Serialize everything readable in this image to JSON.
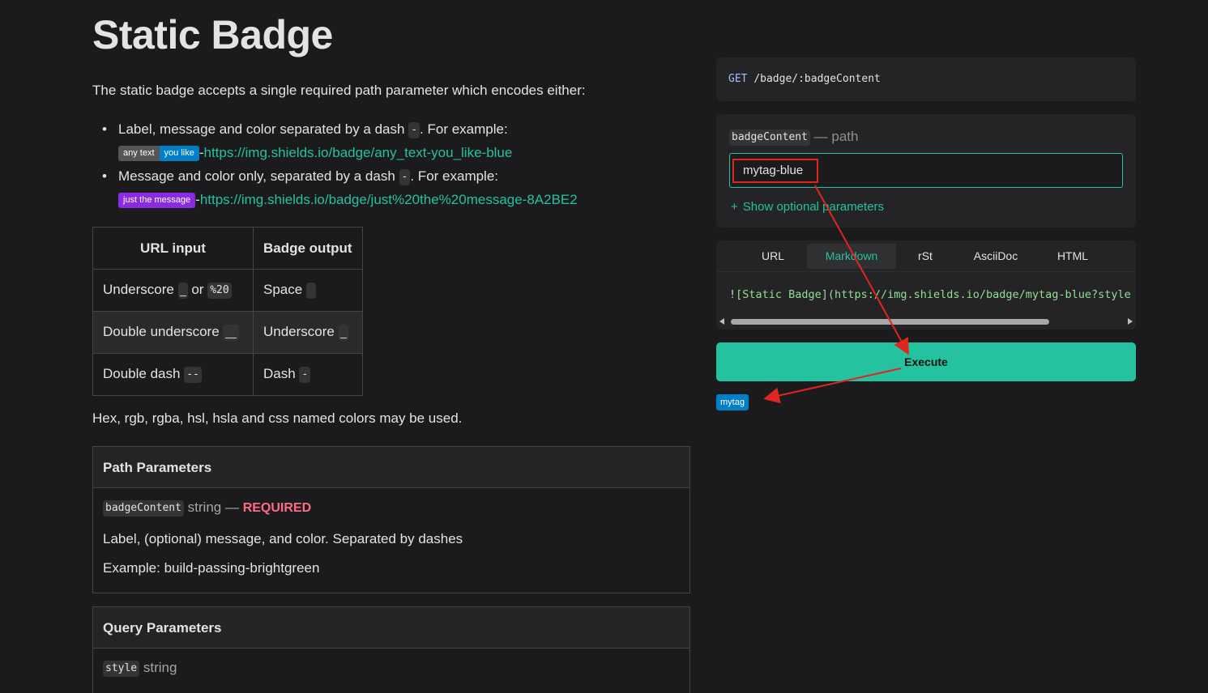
{
  "page": {
    "title": "Static Badge",
    "intro": "The static badge accepts a single required path parameter which encodes either:"
  },
  "bullets": [
    {
      "text_before": "Label, message and color separated by a dash",
      "text_after": ". For example:",
      "code": "-",
      "badge_left": "any text",
      "badge_right": "you like",
      "badge_left_color": "#555555",
      "badge_right_color": "#007ec6",
      "prefix": "-",
      "link": "https://img.shields.io/badge/any_text-you_like-blue"
    },
    {
      "text_before": "Message and color only, separated by a dash",
      "text_after": ". For example:",
      "code": "-",
      "badge_label": "just the message",
      "badge_color": "#8A2BE2",
      "prefix": "-",
      "link": "https://img.shields.io/badge/just%20the%20message-8A2BE2"
    }
  ],
  "mapping_table": {
    "headers": [
      "URL input",
      "Badge output"
    ],
    "rows": [
      {
        "input": "Underscore",
        "input_connector": "or",
        "input_code2": "%20",
        "output": "Space"
      },
      {
        "input": "Double underscore",
        "output": "Underscore"
      },
      {
        "input": "Double dash",
        "input_code": "--",
        "output": "Dash",
        "output_code": "-"
      }
    ]
  },
  "colors_note": "Hex, rgb, rgba, hsl, hsla and css named colors may be used.",
  "path_parameters": {
    "heading": "Path Parameters",
    "name": "badgeContent",
    "type": "string",
    "separator": "—",
    "required_label": "REQUIRED",
    "description": "Label, (optional) message, and color. Separated by dashes",
    "example": "Example: build-passing-brightgreen"
  },
  "query_parameters": {
    "heading": "Query Parameters",
    "name": "style",
    "type": "string"
  },
  "endpoint": {
    "verb": "GET",
    "path": "/badge/:badgeContent"
  },
  "param_form": {
    "name": "badgeContent",
    "kind": "— path",
    "value": "mytag-blue",
    "optional_toggle": "Show optional parameters"
  },
  "tabs": {
    "items": [
      "URL",
      "Markdown",
      "rSt",
      "AsciiDoc",
      "HTML"
    ],
    "active": "Markdown"
  },
  "snippet": {
    "bang": "!",
    "text": "[Static Badge](https://img.shields.io/badge/mytag-blue?style"
  },
  "execute_label": "Execute",
  "result_badge": {
    "label": "mytag",
    "color": "#007ec6"
  },
  "colors": {
    "accent": "#25c2a0",
    "background": "#1b1b1d",
    "panel": "#242426",
    "annotation": "#e0251f"
  }
}
